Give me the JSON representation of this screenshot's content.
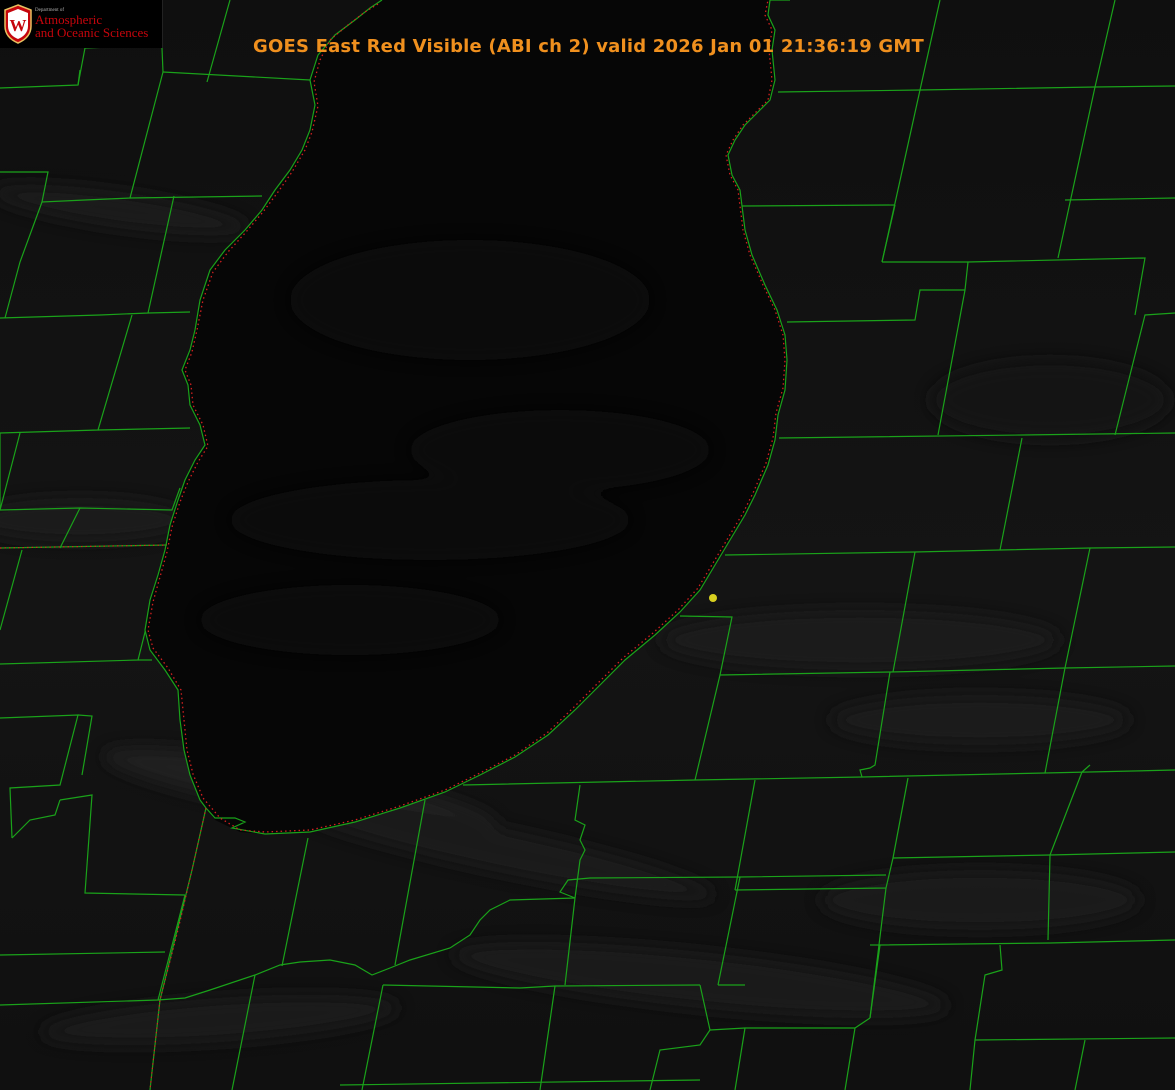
{
  "title": "GOES East Red Visible (ABI ch 2) valid 2026 Jan 01 21:36:19 GMT",
  "logo": {
    "department": "Department of",
    "line1": "Atmospheric",
    "line2": "and Oceanic Sciences",
    "seal_letter": "W"
  },
  "colors": {
    "background": "#0d0d0d",
    "lake": "#060606",
    "county_lines": "#1aa21a",
    "coastline_dotted": "#d42020",
    "title": "#f0901e",
    "point_marker": "#d8d020"
  },
  "layers": [
    "satellite-visible-imagery",
    "lake-surface",
    "county-boundaries",
    "coastline",
    "point-marker"
  ],
  "icons": [
    "uw-seal-icon",
    "point-marker-icon"
  ]
}
